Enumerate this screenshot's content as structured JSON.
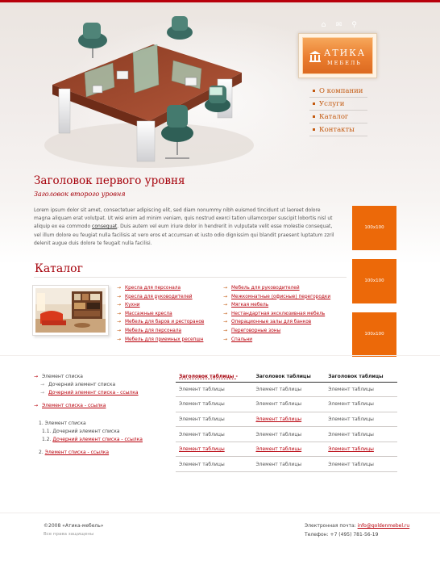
{
  "brand": {
    "name": "АТИКА",
    "tagline": "МЕБЕЛЬ",
    "accent": "#ec6909",
    "primary": "#a5000a"
  },
  "top_icons": [
    {
      "name": "home-icon",
      "glyph": "⌂"
    },
    {
      "name": "mail-icon",
      "glyph": "✉"
    },
    {
      "name": "search-icon",
      "glyph": "⚲"
    }
  ],
  "nav": {
    "items": [
      {
        "label": "О компании"
      },
      {
        "label": "Услуги"
      },
      {
        "label": "Каталог"
      },
      {
        "label": "Контакты"
      }
    ]
  },
  "content": {
    "h1": "Заголовок первого уровня",
    "h2": "Заголовок второго уровня",
    "lead_part1": "Lorem ipsum dolor sit amet, consectetuer adipiscing elit, sed diam nonummy nibh euismod tincidunt ut laoreet dolore magna aliquam erat volutpat. Ut wisi enim ad minim veniam, quis nostrud exerci tation ullamcorper suscipit lobortis nisl ut aliquip ex ea commodo ",
    "lead_link": "consequat",
    "lead_part2": ". Duis autem vel eum iriure dolor in hendrerit in vulputate velit esse molestie consequat, vel illum dolore eu feugiat nulla facilisis at vero eros et accumsan et iusto odio dignissim qui blandit praesent luptatum zzril delenit augue duis dolore te feugait nulla facilisi."
  },
  "placeholders": [
    "100x100",
    "100x100",
    "100x100"
  ],
  "catalog": {
    "title": "Каталог",
    "left": [
      "Кресла для персонала",
      "Кресла для руководителей",
      "Кухни",
      "Массажные кресла",
      "Мебель для баров и ресторанов",
      "Мебель для персонала",
      "Мебель для приемных ресепшн"
    ],
    "right": [
      "Мебель для руководителей",
      "Межкомнатные (офисные) перегородки",
      "Мягкая мебель",
      "Нестандартная эксклюзивная мебель",
      "Операционные залы для банков",
      "Переговорные зоны",
      "Спальни"
    ]
  },
  "list_bullets": {
    "item1": "Элемент списка",
    "sub1": "Дочерний элемент списка",
    "sub2": "Дочерний элемент списка - ссылка",
    "item2": "Элемент списка - ссылка"
  },
  "list_ordered": {
    "item1": "Элемент списка",
    "sub1_num": "1.1.",
    "sub1": "Дочерний элемент списка",
    "sub2_num": "1.2.",
    "sub2": "Дочерний элемент списка - ссылка",
    "item2_num": "2.",
    "item2": "Элемент списка - ссылка",
    "item1_num": "1."
  },
  "table": {
    "headers": [
      "Заголовок таблицы -",
      "Заголовок таблицы",
      "Заголовок таблицы"
    ],
    "cell": "Элемент таблицы",
    "rows": [
      {
        "c1": "Элемент таблицы",
        "c2": "Элемент таблицы",
        "c3": "Элемент таблицы"
      },
      {
        "c1": "Элемент таблицы",
        "c2": "Элемент таблицы",
        "c3": "Элемент таблицы"
      },
      {
        "c1": "Элемент таблицы",
        "c2": "Элемент таблицы",
        "c3": "Элемент таблицы"
      },
      {
        "c1": "Элемент таблицы",
        "c2": "Элемент таблицы",
        "c3": "Элемент таблицы"
      },
      {
        "c1": "Элемент таблицы",
        "c2": "Элемент таблицы",
        "c3": "Элемент таблицы"
      },
      {
        "c1": "Элемент таблицы",
        "c2": "Элемент таблицы",
        "c3": "Элемент таблицы"
      }
    ]
  },
  "footer": {
    "copyright": "©2008 «Атика-мебель»",
    "rights": "Все права защищены",
    "email_label": "Электронная почта: ",
    "email": "info@goldenmebel.ru",
    "phone": "Телефон: +7 (495) 781-56-19"
  }
}
